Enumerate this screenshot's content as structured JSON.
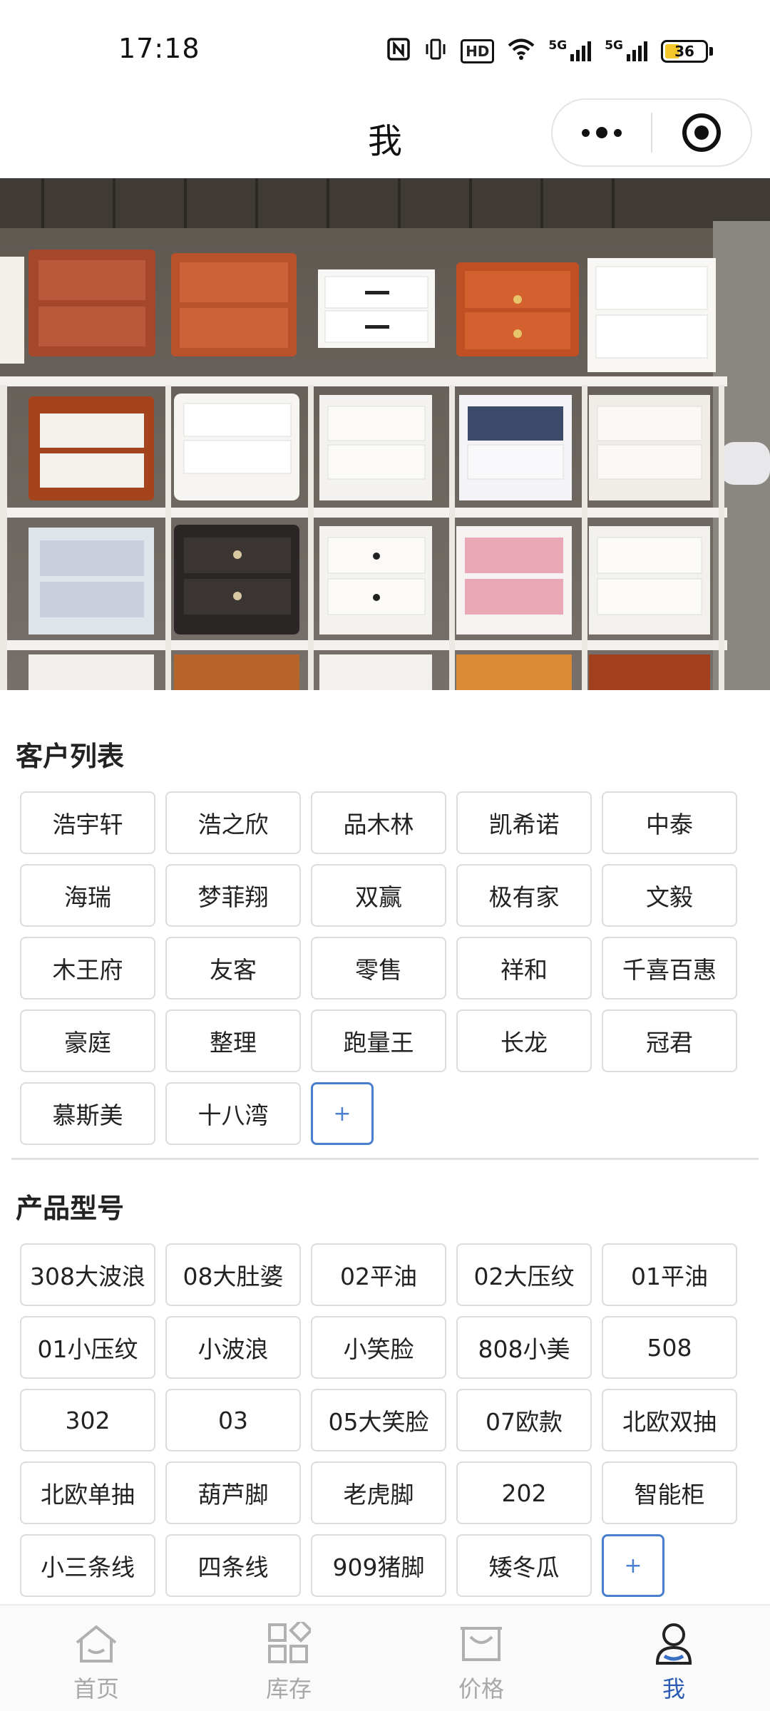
{
  "status_bar": {
    "time": "17:18",
    "icons": [
      "nfc-icon",
      "vibrate-icon",
      "hd-icon",
      "wifi-icon",
      "signal-5g-icon",
      "signal-5g-icon",
      "battery-icon"
    ],
    "hd_label": "HD",
    "net1_label": "5G",
    "net2_label": "5G",
    "battery_level": "36"
  },
  "nav": {
    "title": "我",
    "more_icon": "more-dots-icon",
    "close_icon": "target-circle-icon"
  },
  "hero": {
    "icon": "furniture-photo"
  },
  "customers": {
    "title": "客户列表",
    "items": [
      "浩宇轩",
      "浩之欣",
      "品木林",
      "凯希诺",
      "中泰",
      "海瑞",
      "梦菲翔",
      "双赢",
      "极有家",
      "文毅",
      "木王府",
      "友客",
      "零售",
      "祥和",
      "千喜百惠",
      "豪庭",
      "整理",
      "跑量王",
      "长龙",
      "冠君",
      "慕斯美",
      "十八湾"
    ],
    "add_label": "+"
  },
  "products": {
    "title": "产品型号",
    "items": [
      "308大波浪",
      "08大肚婆",
      "02平油",
      "02大压纹",
      "01平油",
      "01小压纹",
      "小波浪",
      "小笑脸",
      "808小美",
      "508",
      "302",
      "03",
      "05大笑脸",
      "07欧款",
      "北欧双抽",
      "北欧单抽",
      "葫芦脚",
      "老虎脚",
      "202",
      "智能柜",
      "小三条线",
      "四条线",
      "909猪脚",
      "矮冬瓜"
    ],
    "add_label": "+"
  },
  "tabbar": {
    "items": [
      {
        "label": "首页",
        "icon": "home-icon"
      },
      {
        "label": "库存",
        "icon": "inventory-grid-icon"
      },
      {
        "label": "价格",
        "icon": "price-basin-icon"
      },
      {
        "label": "我",
        "icon": "profile-icon"
      }
    ],
    "active_index": 3,
    "colors": {
      "active": "#2d5db3",
      "inactive": "#a8a8a8"
    }
  },
  "colors": {
    "accent": "#4a7fd0",
    "tag_border": "#dcdcdc",
    "divider": "#e2e2e2"
  }
}
